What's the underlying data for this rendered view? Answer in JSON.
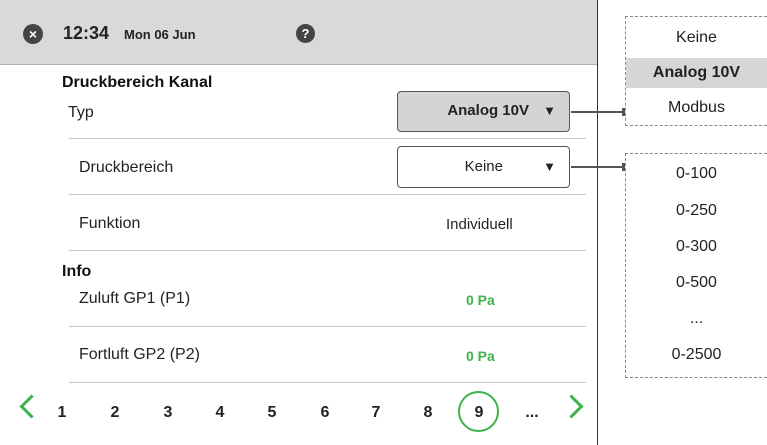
{
  "header": {
    "time": "12:34",
    "date": "Mon 06 Jun",
    "close_icon": "×",
    "help_icon": "?"
  },
  "sections": {
    "pressure_title": "Druckbereich Kanal",
    "info_title": "Info"
  },
  "rows": {
    "typ_label": "Typ",
    "typ_value": "Analog 10V",
    "druckbereich_label": "Druckbereich",
    "druckbereich_value": "Keine",
    "funktion_label": "Funktion",
    "funktion_value": "Individuell",
    "zuluft_label": "Zuluft GP1 (P1)",
    "zuluft_value": "0 Pa",
    "fortluft_label": "Fortluft GP2 (P2)",
    "fortluft_value": "0 Pa"
  },
  "dropdown_arrow": "▼",
  "pager": {
    "pages": [
      "1",
      "2",
      "3",
      "4",
      "5",
      "6",
      "7",
      "8",
      "9"
    ],
    "active": "9",
    "more": "..."
  },
  "typ_options": [
    "Keine",
    "Analog 10V",
    "Modbus"
  ],
  "typ_selected": "Analog 10V",
  "range_options": [
    "0-100",
    "0-250",
    "0-300",
    "0-500",
    "...",
    "0-2500"
  ],
  "colors": {
    "accent_green": "#3cb44b",
    "header_bg": "#d9d9d9",
    "selected_bg": "#d4d4d4"
  }
}
